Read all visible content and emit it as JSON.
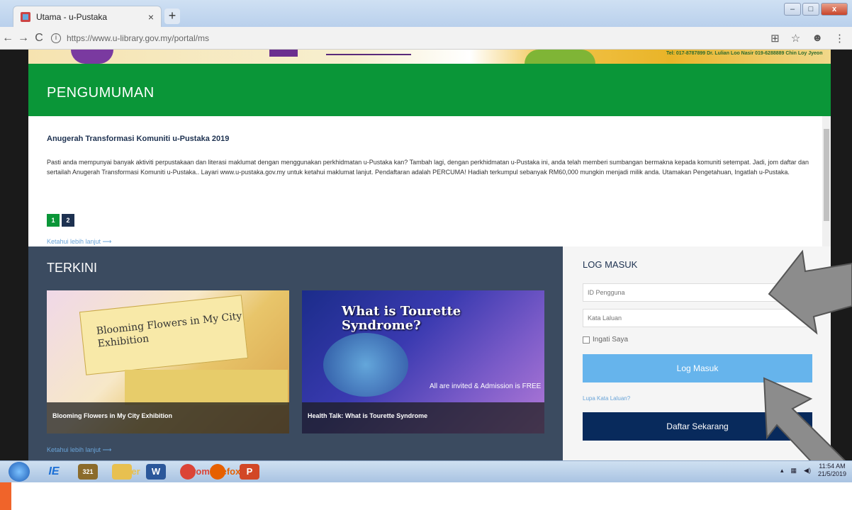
{
  "browser": {
    "tab_title": "Utama - u-Pustaka",
    "tab_close": "×",
    "new_tab": "+",
    "url": "https://www.u-library.gov.my/portal/ms",
    "window_controls": {
      "minimize": "–",
      "maximize": "□",
      "close": "x"
    }
  },
  "banner": {
    "text": "Tel: 017-8787899 Dr. Lulian Loo Nasir 019-6288889 Chin Loy Jyeon"
  },
  "announcements": {
    "heading": "PENGUMUMAN",
    "title": "Anugerah Transformasi Komuniti u-Pustaka 2019",
    "body": "Pasti anda mempunyai banyak aktiviti perpustakaan dan literasi maklumat dengan menggunakan perkhidmatan u-Pustaka kan? Tambah lagi, dengan perkhidmatan u-Pustaka ini, anda telah memberi sumbangan bermakna kepada komuniti setempat. Jadi, jom daftar dan sertailah Anugerah Transformasi Komuniti u-Pustaka.. Layari www.u-pustaka.gov.my untuk ketahui maklumat lanjut. Pendaftaran adalah PERCUMA! Hadiah terkumpul sebanyak RM60,000 mungkin menjadi milik anda. Utamakan Pengetahuan, Ingatlah u-Pustaka.",
    "pages": [
      "1",
      "2"
    ],
    "more": "Ketahui lebih lanjut  ⟶"
  },
  "latest": {
    "heading": "TERKINI",
    "cards": [
      {
        "caption": "Blooming Flowers in My City Exhibition",
        "poster": "Blooming Flowers in My City Exhibition"
      },
      {
        "caption": "Health Talk: What is Tourette Syndrome",
        "poster": "What is Tourette Syndrome?",
        "sub": "All are invited & Admission is FREE"
      }
    ],
    "more": "Ketahui lebih lanjut  ⟶"
  },
  "login": {
    "heading": "LOG MASUK",
    "username_placeholder": "ID Pengguna",
    "password_placeholder": "Kata Laluan",
    "remember": "Ingati Saya",
    "login_button": "Log Masuk",
    "forgot": "Lupa Kata Laluan?",
    "register_button": "Daftar Sekarang"
  },
  "taskbar": {
    "time": "11:54 AM",
    "date": "21/5/2019",
    "apps": [
      "IE",
      "321",
      "Folder",
      "W",
      "Chrome",
      "Firefox",
      "P"
    ]
  },
  "colors": {
    "green": "#0a9638",
    "navy": "#1d3150",
    "slate": "#3b4b60",
    "button_blue": "#66b4ec",
    "button_navy": "#082a5c"
  }
}
